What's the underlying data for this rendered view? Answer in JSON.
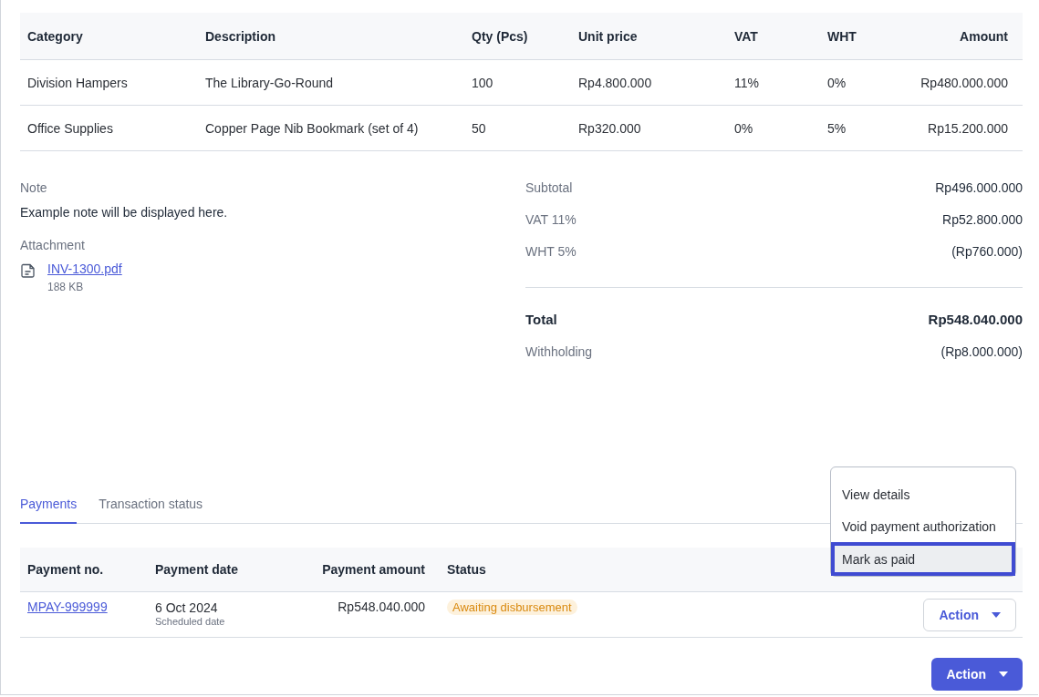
{
  "items_table": {
    "columns": [
      "Category",
      "Description",
      "Qty (Pcs)",
      "Unit price",
      "VAT",
      "WHT",
      "Amount"
    ],
    "rows": [
      [
        "Division Hampers",
        "The Library-Go-Round",
        "100",
        "Rp4.800.000",
        "11%",
        "0%",
        "Rp480.000.000"
      ],
      [
        "Office Supplies",
        "Copper Page Nib Bookmark (set of 4)",
        "50",
        "Rp320.000",
        "0%",
        "5%",
        "Rp15.200.000"
      ]
    ]
  },
  "note": {
    "label": "Note",
    "text": "Example note will be displayed here."
  },
  "attachment": {
    "label": "Attachment",
    "file_name": "INV-1300.pdf",
    "file_size": "188 KB"
  },
  "summary": [
    {
      "label": "Subtotal",
      "value": "Rp496.000.000",
      "kind": "line"
    },
    {
      "label": "VAT 11%",
      "value": "Rp52.800.000",
      "kind": "line"
    },
    {
      "label": "WHT 5%",
      "value": "(Rp760.000)",
      "kind": "line"
    },
    {
      "label": "Total",
      "value": "Rp548.040.000",
      "kind": "total"
    },
    {
      "label": "Withholding",
      "value": "(Rp8.000.000)",
      "kind": "line"
    }
  ],
  "tabs": [
    {
      "label": "Payments",
      "selected": true
    },
    {
      "label": "Transaction status",
      "selected": false
    }
  ],
  "payments_table": {
    "columns": [
      "Payment no.",
      "Payment date",
      "Payment amount",
      "Status"
    ],
    "rows": [
      {
        "payment_no": "MPAY-999999",
        "date": "6 Oct 2024",
        "date_note": "Scheduled date",
        "amount": "Rp548.040.000",
        "status": {
          "text": "Awaiting disbursement",
          "kind": "warning"
        },
        "action": "Action"
      }
    ]
  },
  "action_menu": {
    "items": [
      {
        "label": "View details",
        "selected": false
      },
      {
        "label": "Void payment authorization",
        "selected": false
      },
      {
        "label": "Mark as paid",
        "selected": true
      }
    ]
  },
  "primary_action": "Action"
}
